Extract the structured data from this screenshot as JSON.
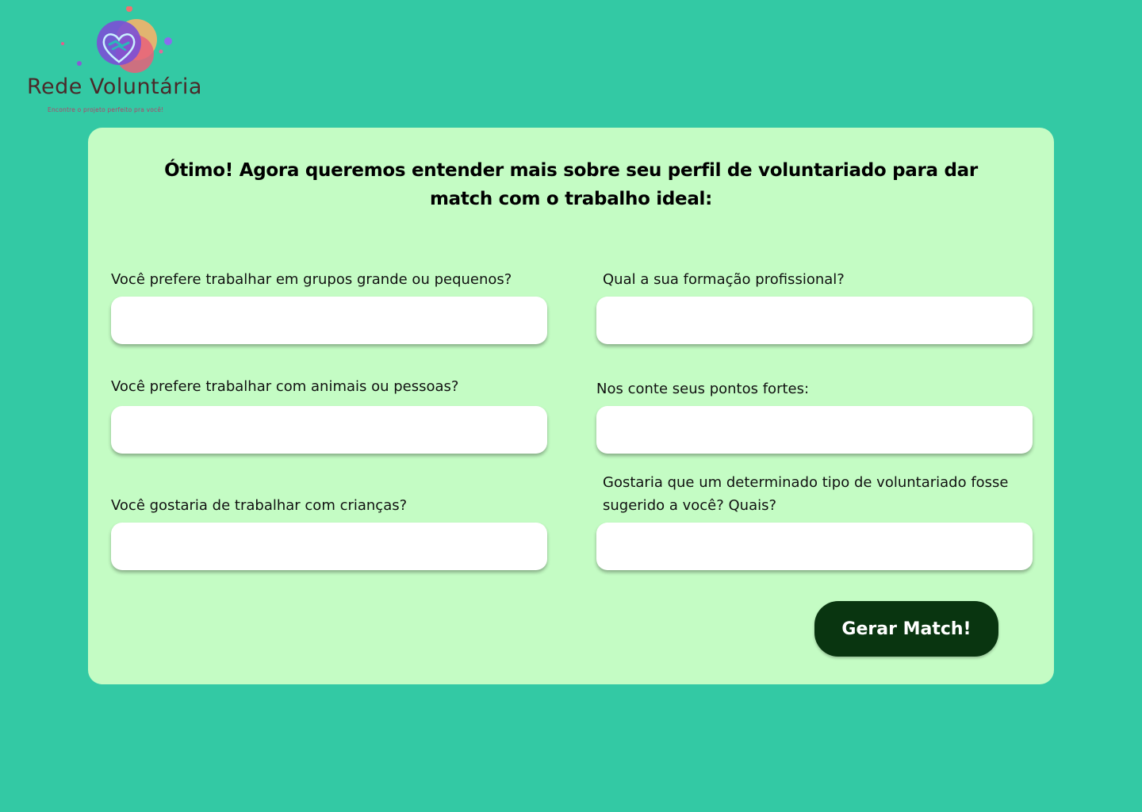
{
  "brand": {
    "name": "Rede Voluntária",
    "tagline": "Encontre o projeto perfeito pra você!",
    "logo_icon": "heart-handshake-icon",
    "colors": {
      "purple": "#7b4fd6",
      "pink": "#e8607a",
      "orange": "#f4b26a",
      "blue": "#6a8cf0"
    }
  },
  "form": {
    "heading": "Ótimo! Agora queremos entender mais sobre seu perfil de voluntariado para dar match com o trabalho ideal:",
    "fields": [
      {
        "label": "Você prefere trabalhar em grupos grande ou pequenos?",
        "value": "",
        "placeholder": ""
      },
      {
        "label": "Qual a sua formação profissional?",
        "value": "",
        "placeholder": ""
      },
      {
        "label": "Você prefere trabalhar com animais ou pessoas?",
        "value": "",
        "placeholder": ""
      },
      {
        "label": "Nos conte seus pontos fortes:",
        "value": "",
        "placeholder": ""
      },
      {
        "label": "Você gostaria de trabalhar com crianças?",
        "value": "",
        "placeholder": ""
      },
      {
        "label": "Gostaria que um determinado tipo de voluntariado fosse sugerido a você? Quais?",
        "value": "",
        "placeholder": ""
      }
    ],
    "submit_label": "Gerar Match!"
  },
  "colors": {
    "page_background": "#33c9a4",
    "card_background": "#c4fcc4",
    "button_background": "#093510",
    "button_text": "#ffffff"
  }
}
